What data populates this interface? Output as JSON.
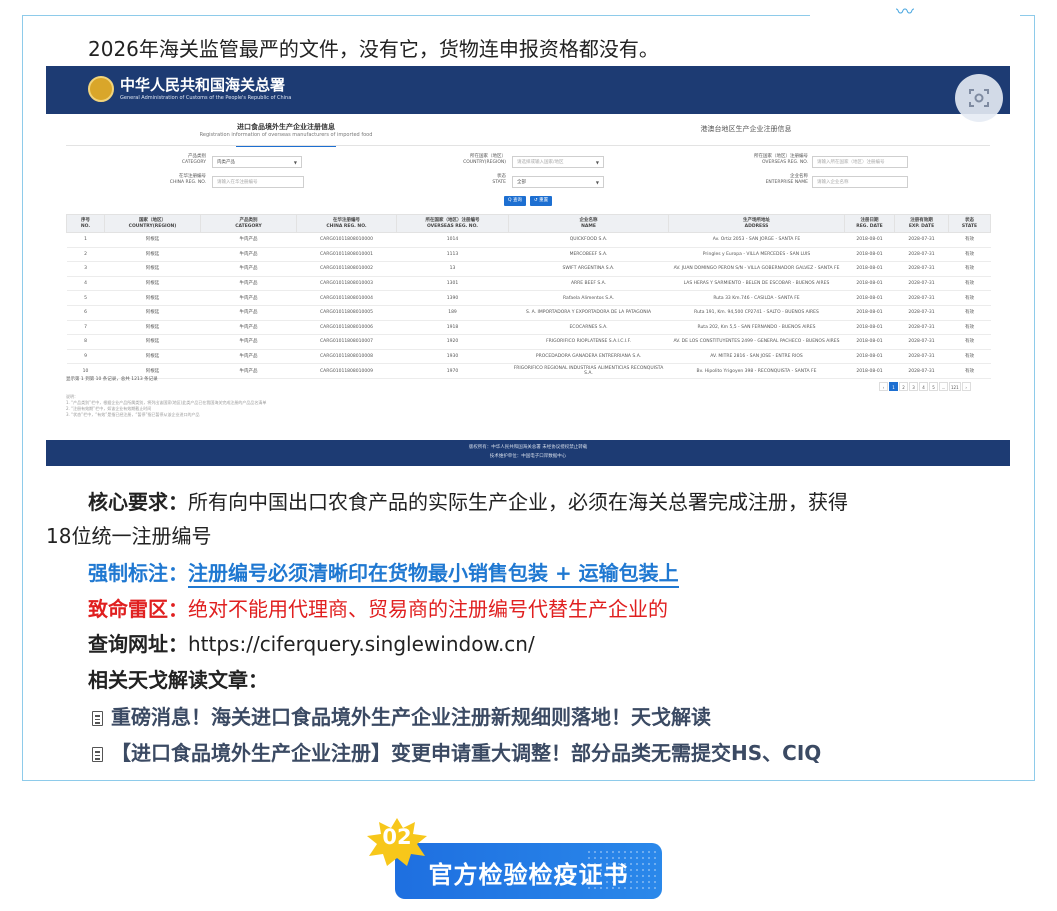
{
  "intro": "2026年海关监管最严的文件，没有它，货物连申报资格都没有。",
  "site": {
    "org_cn": "中华人民共和国海关总署",
    "org_en": "General Administration of Customs of the People's Republic of China",
    "tab_active_cn": "进口食品境外生产企业注册信息",
    "tab_active_en": "Registration information of overseas manufacturers of imported food",
    "tab_other": "港澳台地区生产企业注册信息"
  },
  "filters": {
    "category_cn": "产品类别",
    "category_en": "CATEGORY",
    "category_value": "肉类产品",
    "country_cn": "所在国家（地区）",
    "country_en": "COUNTRY(REGION)",
    "country_ph": "请选择或输入国家/地区",
    "overseas_cn": "所在国家（地区）注册编号",
    "overseas_en": "OVERSEAS REG. NO.",
    "overseas_ph": "请输入所在国家（地区）注册编号",
    "china_cn": "在华注册编号",
    "china_en": "CHINA REG. NO.",
    "china_ph": "请输入在华注册编号",
    "state_cn": "状态",
    "state_en": "STATE",
    "state_value": "全部",
    "name_cn": "企业名称",
    "name_en": "ENTERPRISE NAME",
    "name_ph": "请输入企业名称",
    "search": "Q 查询",
    "reset": "↺ 重置"
  },
  "table": {
    "headers": [
      {
        "cn": "序号",
        "en": "NO."
      },
      {
        "cn": "国家（地区）",
        "en": "COUNTRY(REGION)"
      },
      {
        "cn": "产品类别",
        "en": "CATEGORY"
      },
      {
        "cn": "在华注册编号",
        "en": "CHINA REG. NO."
      },
      {
        "cn": "所在国家（地区）注册编号",
        "en": "OVERSEAS REG. NO."
      },
      {
        "cn": "企业名称",
        "en": "NAME"
      },
      {
        "cn": "生产场所地址",
        "en": "ADDRESS"
      },
      {
        "cn": "注册日期",
        "en": "REG. DATE"
      },
      {
        "cn": "注册有效期",
        "en": "EXP. DATE"
      },
      {
        "cn": "状态",
        "en": "STATE"
      }
    ],
    "rows": [
      [
        "1",
        "阿根廷",
        "牛肉产品",
        "CARG01011808010000",
        "1014",
        "QUICKFOOD S.A.",
        "Av. Ortiz 2053 - SAN JORGE - SANTA FE",
        "2018-08-01",
        "2028-07-31",
        "有效"
      ],
      [
        "2",
        "阿根廷",
        "牛肉产品",
        "CARG01011808010001",
        "1113",
        "MERCOBEEF S.A.",
        "Pringles y Europa - VILLA MERCEDES - SAN LUIS",
        "2018-08-01",
        "2028-07-31",
        "有效"
      ],
      [
        "3",
        "阿根廷",
        "牛肉产品",
        "CARG01011808010002",
        "13",
        "SWIFT ARGENTINA S.A.",
        "AV. JUAN DOMINGO PERON S/N - VILLA GOBERNADOR GALVEZ - SANTA FE",
        "2018-08-01",
        "2028-07-31",
        "有效"
      ],
      [
        "4",
        "阿根廷",
        "牛肉产品",
        "CARG01011808010003",
        "1301",
        "ARRE BEEF S.A.",
        "LAS HERAS Y SARMIENTO - BELEN DE ESCOBAR - BUENOS AIRES",
        "2018-08-01",
        "2028-07-31",
        "有效"
      ],
      [
        "5",
        "阿根廷",
        "牛肉产品",
        "CARG01011808010004",
        "1390",
        "Rafaela Alimentos S.A.",
        "Ruta 33 Km.746 - CASILDA - SANTA FE",
        "2018-08-01",
        "2028-07-31",
        "有效"
      ],
      [
        "6",
        "阿根廷",
        "牛肉产品",
        "CARG01011808010005",
        "189",
        "S. A. IMPORTADORA Y EXPORTADORA DE LA PATAGONIA",
        "Ruta 191, Km. 94,500 CP2741 - SALTO - BUENOS AIRES",
        "2018-08-01",
        "2028-07-31",
        "有效"
      ],
      [
        "7",
        "阿根廷",
        "牛肉产品",
        "CARG01011808010006",
        "1918",
        "ECOCARNES S.A.",
        "Ruta 202, Km 5,5 - SAN FERNANDO - BUENOS AIRES",
        "2018-08-01",
        "2028-07-31",
        "有效"
      ],
      [
        "8",
        "阿根廷",
        "牛肉产品",
        "CARG01011808010007",
        "1920",
        "FRIGORIFICO RIOPLATENSE S.A.I.C.I.F.",
        "AV. DE LOS CONSTITUYENTES 2499 - GENERAL PACHECO - BUENOS AIRES",
        "2018-08-01",
        "2028-07-31",
        "有效"
      ],
      [
        "9",
        "阿根廷",
        "牛肉产品",
        "CARG01011808010008",
        "1930",
        "PROCEDADORA GANADERA ENTRERRIANA S.A.",
        "AV. MITRE 2816 - SAN JOSE - ENTRE RIOS",
        "2018-08-01",
        "2028-07-31",
        "有效"
      ],
      [
        "10",
        "阿根廷",
        "牛肉产品",
        "CARG01011808010009",
        "1970",
        "FRIGORIFICO REGIONAL INDUSTRIAS ALIMENTICIAS RECONQUISTA S.A.",
        "Bv. Hipolito Yrigoyen 398 - RECONQUISTA - SANTA FE",
        "2018-08-01",
        "2028-07-31",
        "有效"
      ]
    ],
    "summary": "显示第 1 到第 10 条记录，总共 1213 条记录",
    "pages": [
      "‹",
      "1",
      "2",
      "3",
      "4",
      "5",
      "...",
      "121",
      "›"
    ]
  },
  "notes": {
    "title": "说明：",
    "lines": [
      "1. “产品类别”栏中，根据企业产品所属类别，将列出该国家(地区)此类产品已在我国海关完成注册的产品品名清单",
      "2. “注册有效期”栏中，如该企业有效期截止时间",
      "3. “状态”栏中，“有效”是指已经注册，“暂停”指已暂停从该企业进口的产品"
    ]
  },
  "footer": {
    "line1": "版权所有：中华人民共和国海关总署 未经协议授权禁止转载",
    "line2": "技术维护单位：中国电子口岸数据中心"
  },
  "body": {
    "core_label": "核心要求：",
    "core_text_1": "所有向中国出口农食产品的实际生产企业，必须在海关总署完成注册，获得",
    "core_text_2": "18位统一注册编号",
    "mark_label": "强制标注：",
    "mark_text": "注册编号必须清晰印在货物最小销售包装 + 运输包装上",
    "risk_label": "致命雷区：",
    "risk_text": "绝对不能用代理商、贸易商的注册编号代替生产企业的",
    "query_label": "查询网址：",
    "query_url": "https://ciferquery.singlewindow.cn/",
    "related_label": "相关天戈解读文章：",
    "article1": "重磅消息！海关进口食品境外生产企业注册新规细则落地！天戈解读",
    "article2": "【进口食品境外生产企业注册】变更申请重大调整！部分品类无需提交HS、CIQ"
  },
  "badge": {
    "number": "02",
    "title": "官方检验检疫证书"
  },
  "colors": {
    "header_navy": "#1d3b73",
    "accent_blue": "#1f78d1",
    "warning_red": "#e02020",
    "card_border": "#8ecbea"
  }
}
